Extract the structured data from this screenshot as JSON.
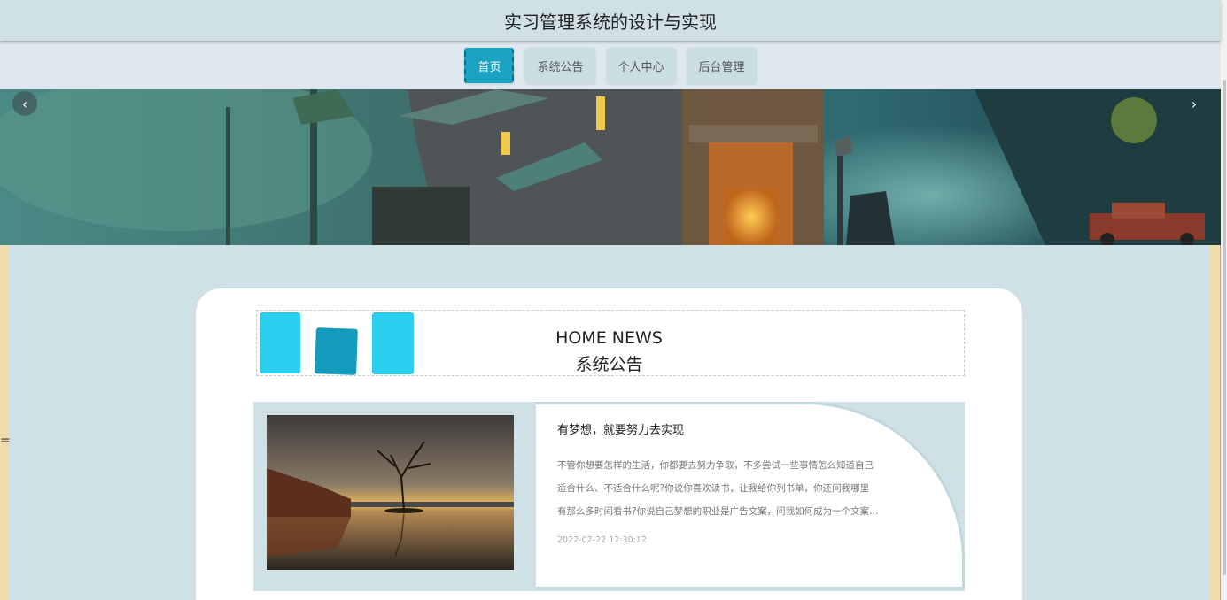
{
  "app": {
    "title": "实习管理系统的设计与实现"
  },
  "nav": {
    "items": [
      {
        "label": "首页",
        "active": true
      },
      {
        "label": "系统公告",
        "active": false
      },
      {
        "label": "个人中心",
        "active": false
      },
      {
        "label": "后台管理",
        "active": false
      }
    ]
  },
  "banner": {
    "prev_icon": "‹",
    "next_icon": "›"
  },
  "news": {
    "heading_en": "HOME NEWS",
    "heading_cn": "系统公告",
    "items": [
      {
        "title": "有梦想，就要努力去实现",
        "desc_lines": [
          "不管你想要怎样的生活，你都要去努力争取，不多尝试一些事情怎么知道自己",
          "适合什么、不适合什么呢?你说你喜欢读书，让我给你列书单，你还问我哪里",
          "有那么多时间看书?你说自己梦想的职业是广告文案，问我如何成为一个文案..."
        ],
        "date": "2022-02-22 12:30:12"
      }
    ]
  },
  "colors": {
    "accent": "#1aa2c0",
    "page_bg": "#cfe0e6",
    "block_light": "#29cdee",
    "block_dark": "#129bba"
  }
}
